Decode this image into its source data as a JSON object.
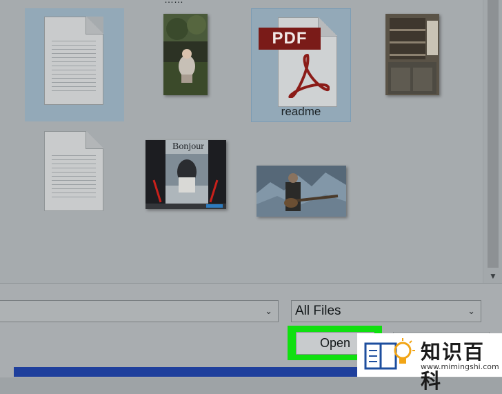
{
  "files": [
    {
      "label": "",
      "type": "document",
      "selected": true
    },
    {
      "label": "",
      "type": "photo",
      "subject": "child-on-grass"
    },
    {
      "label": "readme",
      "type": "pdf",
      "selected": true,
      "badge": "PDF"
    },
    {
      "label": "",
      "type": "photo",
      "subject": "kitchen-shelves"
    },
    {
      "label": "",
      "type": "document"
    },
    {
      "label": "",
      "type": "photo",
      "subject": "bonjour-webpage",
      "caption": "Bonjour"
    },
    {
      "label": "",
      "type": "photo",
      "subject": "guitarist"
    }
  ],
  "top_cut_label": "……",
  "file_type_filter": {
    "value": "All Files"
  },
  "buttons": {
    "open": "Open",
    "cancel": ""
  },
  "watermark": {
    "text": "知识百科",
    "url": "www.mimingshi.com"
  },
  "colors": {
    "selection": "#93a9b8",
    "highlight": "#10e010",
    "pdf_red": "#7a1b18"
  }
}
